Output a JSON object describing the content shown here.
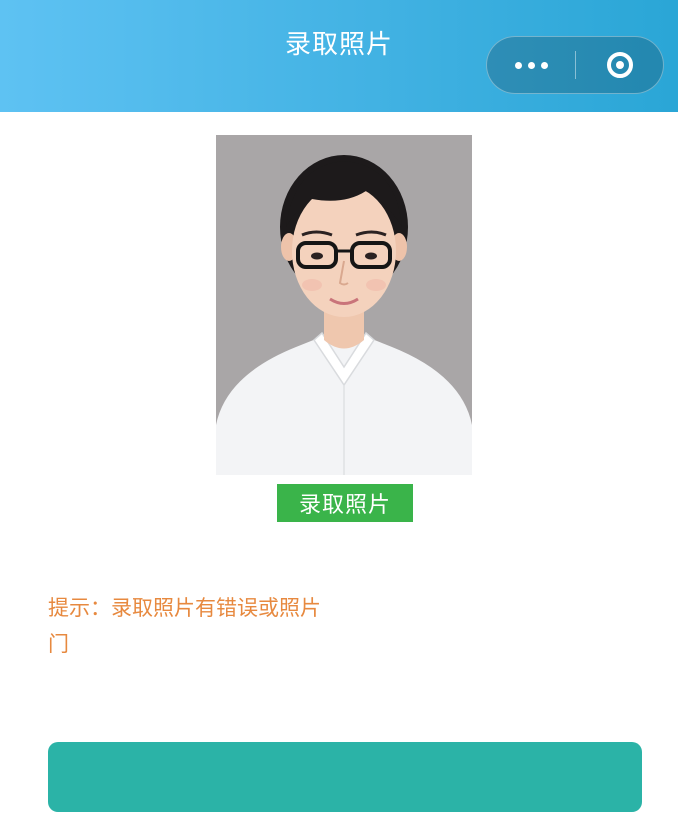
{
  "header": {
    "title": "录取照片",
    "bg_color": "#42b2e3",
    "capsule_more_icon": "more-dots-icon",
    "capsule_close_icon": "miniprogram-close-icon"
  },
  "photo": {
    "description_icon": "admission-photo"
  },
  "record_button": {
    "label": "录取照片",
    "color": "#3ab44a"
  },
  "tip": {
    "line1": "提示：录取照片有错误或照片",
    "line2": "门",
    "color": "#e7893f"
  },
  "bottom_button": {
    "label": "",
    "color": "#2bb3a7"
  }
}
